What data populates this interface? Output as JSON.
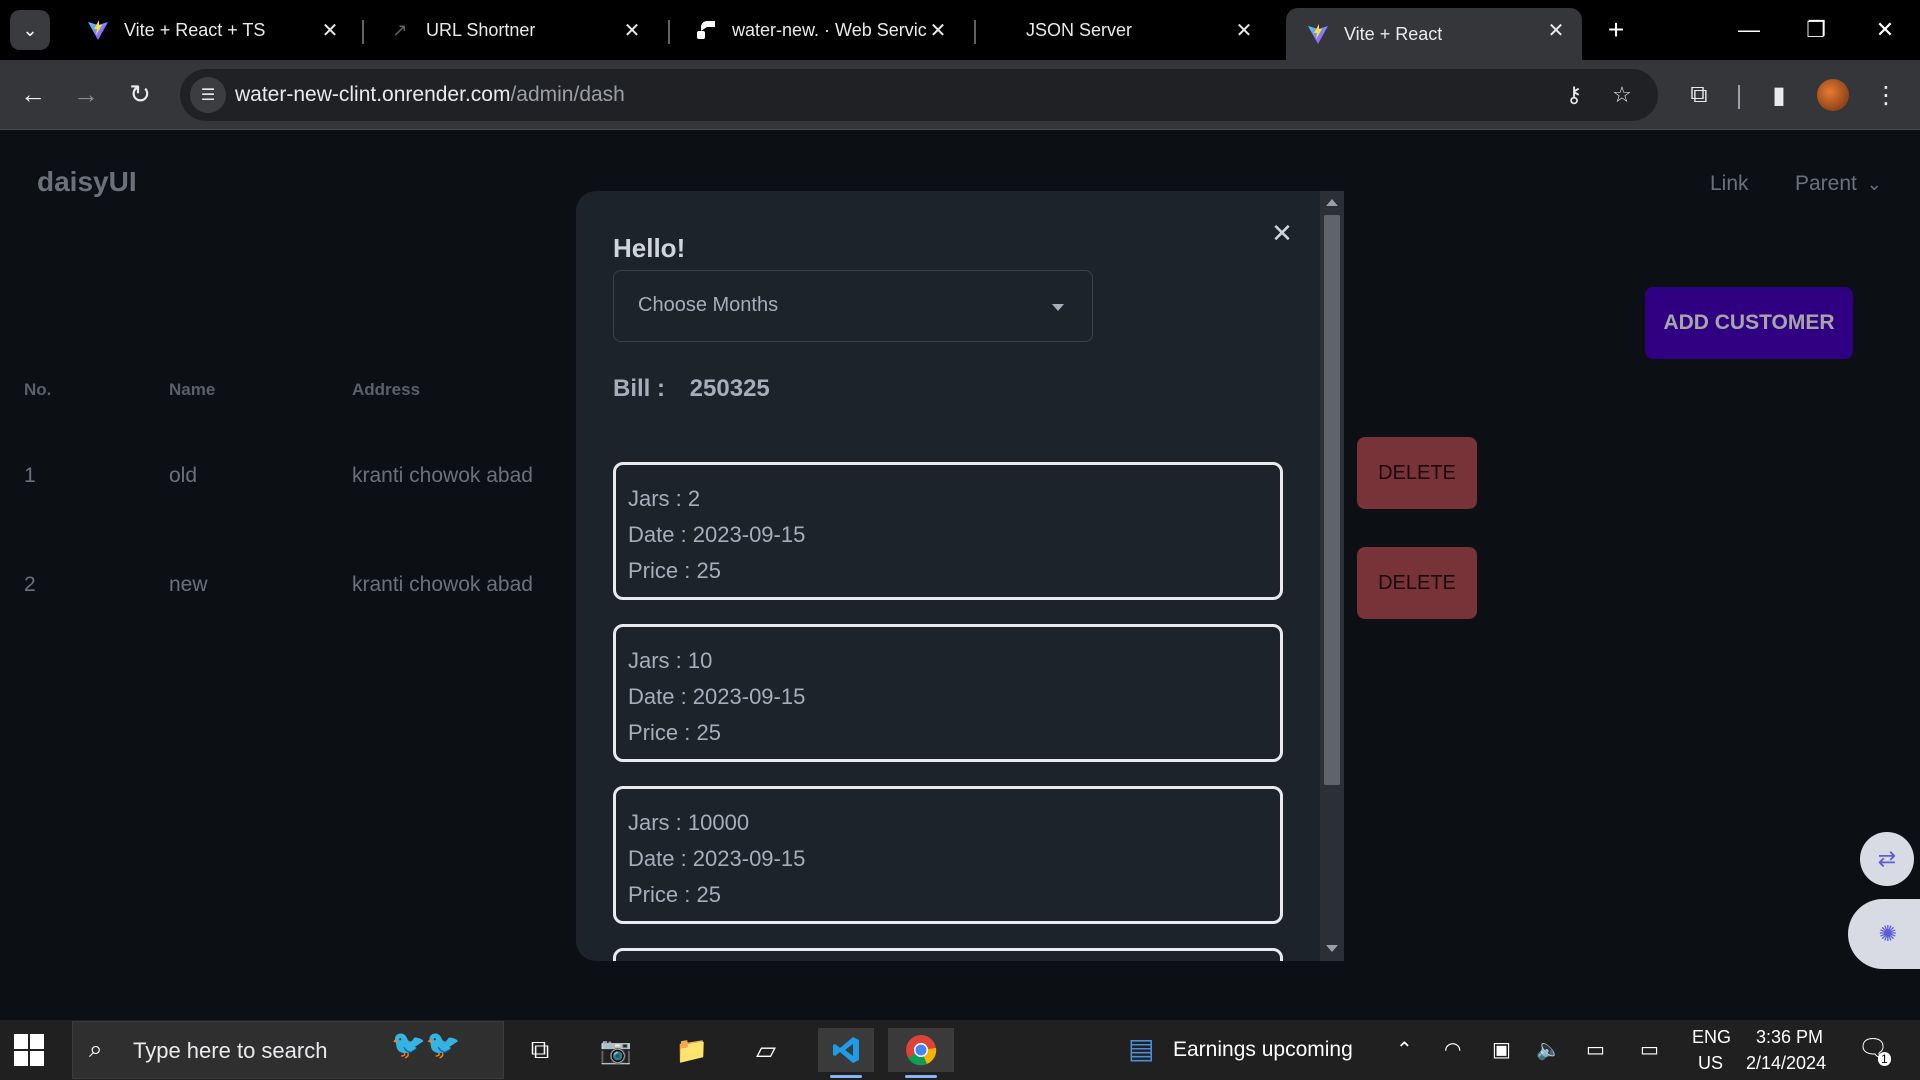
{
  "browser": {
    "tabs": [
      {
        "title": "Vite + React + TS",
        "favicon": "vite-icon",
        "active": false
      },
      {
        "title": "URL Shortner",
        "favicon": "link-icon",
        "active": false
      },
      {
        "title": "water-new. · Web Servic",
        "favicon": "render-icon",
        "active": false
      },
      {
        "title": "JSON Server",
        "favicon": "none",
        "active": false
      },
      {
        "title": "Vite + React",
        "favicon": "vite-icon",
        "active": true
      }
    ],
    "url_host": "water-new-clint.onrender.com",
    "url_path": "/admin/dash"
  },
  "app": {
    "brand": "daisyUI",
    "nav": {
      "link": "Link",
      "parent": "Parent"
    },
    "add_customer": "ADD CUSTOMER",
    "table": {
      "headers": [
        "No.",
        "Name",
        "Address"
      ],
      "rows": [
        {
          "no": "1",
          "name": "old",
          "address": "kranti chowok abad",
          "delete": "DELETE"
        },
        {
          "no": "2",
          "name": "new",
          "address": "kranti chowok abad",
          "delete": "DELETE"
        }
      ]
    }
  },
  "modal": {
    "title": "Hello!",
    "select_value": "Choose Months",
    "bill_label": "Bill :",
    "bill_amount": "250325",
    "entries": [
      {
        "jars": "Jars : 2",
        "date": "Date : 2023-09-15",
        "price": "Price : 25"
      },
      {
        "jars": "Jars : 10",
        "date": "Date : 2023-09-15",
        "price": "Price : 25"
      },
      {
        "jars": "Jars : 10000",
        "date": "Date : 2023-09-15",
        "price": "Price : 25"
      }
    ]
  },
  "taskbar": {
    "search_placeholder": "Type here to search",
    "news": "Earnings upcoming",
    "lang_top": "ENG",
    "lang_bottom": "US",
    "time": "3:36 PM",
    "date": "2/14/2024",
    "notification_count": "1"
  }
}
